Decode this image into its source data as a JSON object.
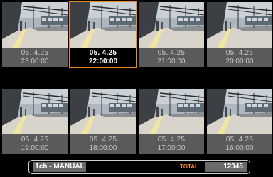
{
  "thumbnails": [
    {
      "date": "05. 4.25",
      "time": "23:00:00",
      "selected": false
    },
    {
      "date": "05. 4.25",
      "time": "22:00:00",
      "selected": true
    },
    {
      "date": "05. 4.25",
      "time": "21:00:00",
      "selected": false
    },
    {
      "date": "05. 4.25",
      "time": "20:00:00",
      "selected": false
    },
    {
      "date": "05. 4.25",
      "time": "19:00:00",
      "selected": false
    },
    {
      "date": "05. 4.25",
      "time": "18:00:00",
      "selected": false
    },
    {
      "date": "05. 4.25",
      "time": "17:00:00",
      "selected": false
    },
    {
      "date": "05. 4.25",
      "time": "16:00:00",
      "selected": false
    }
  ],
  "status": {
    "mode": "1ch - MANUAL",
    "total_label": "TOTAL",
    "total_value": "12345"
  },
  "colors": {
    "accent": "#f08a1e",
    "caption_bg": "#5a5a5a",
    "panel_bg": "#6a6a6a"
  }
}
